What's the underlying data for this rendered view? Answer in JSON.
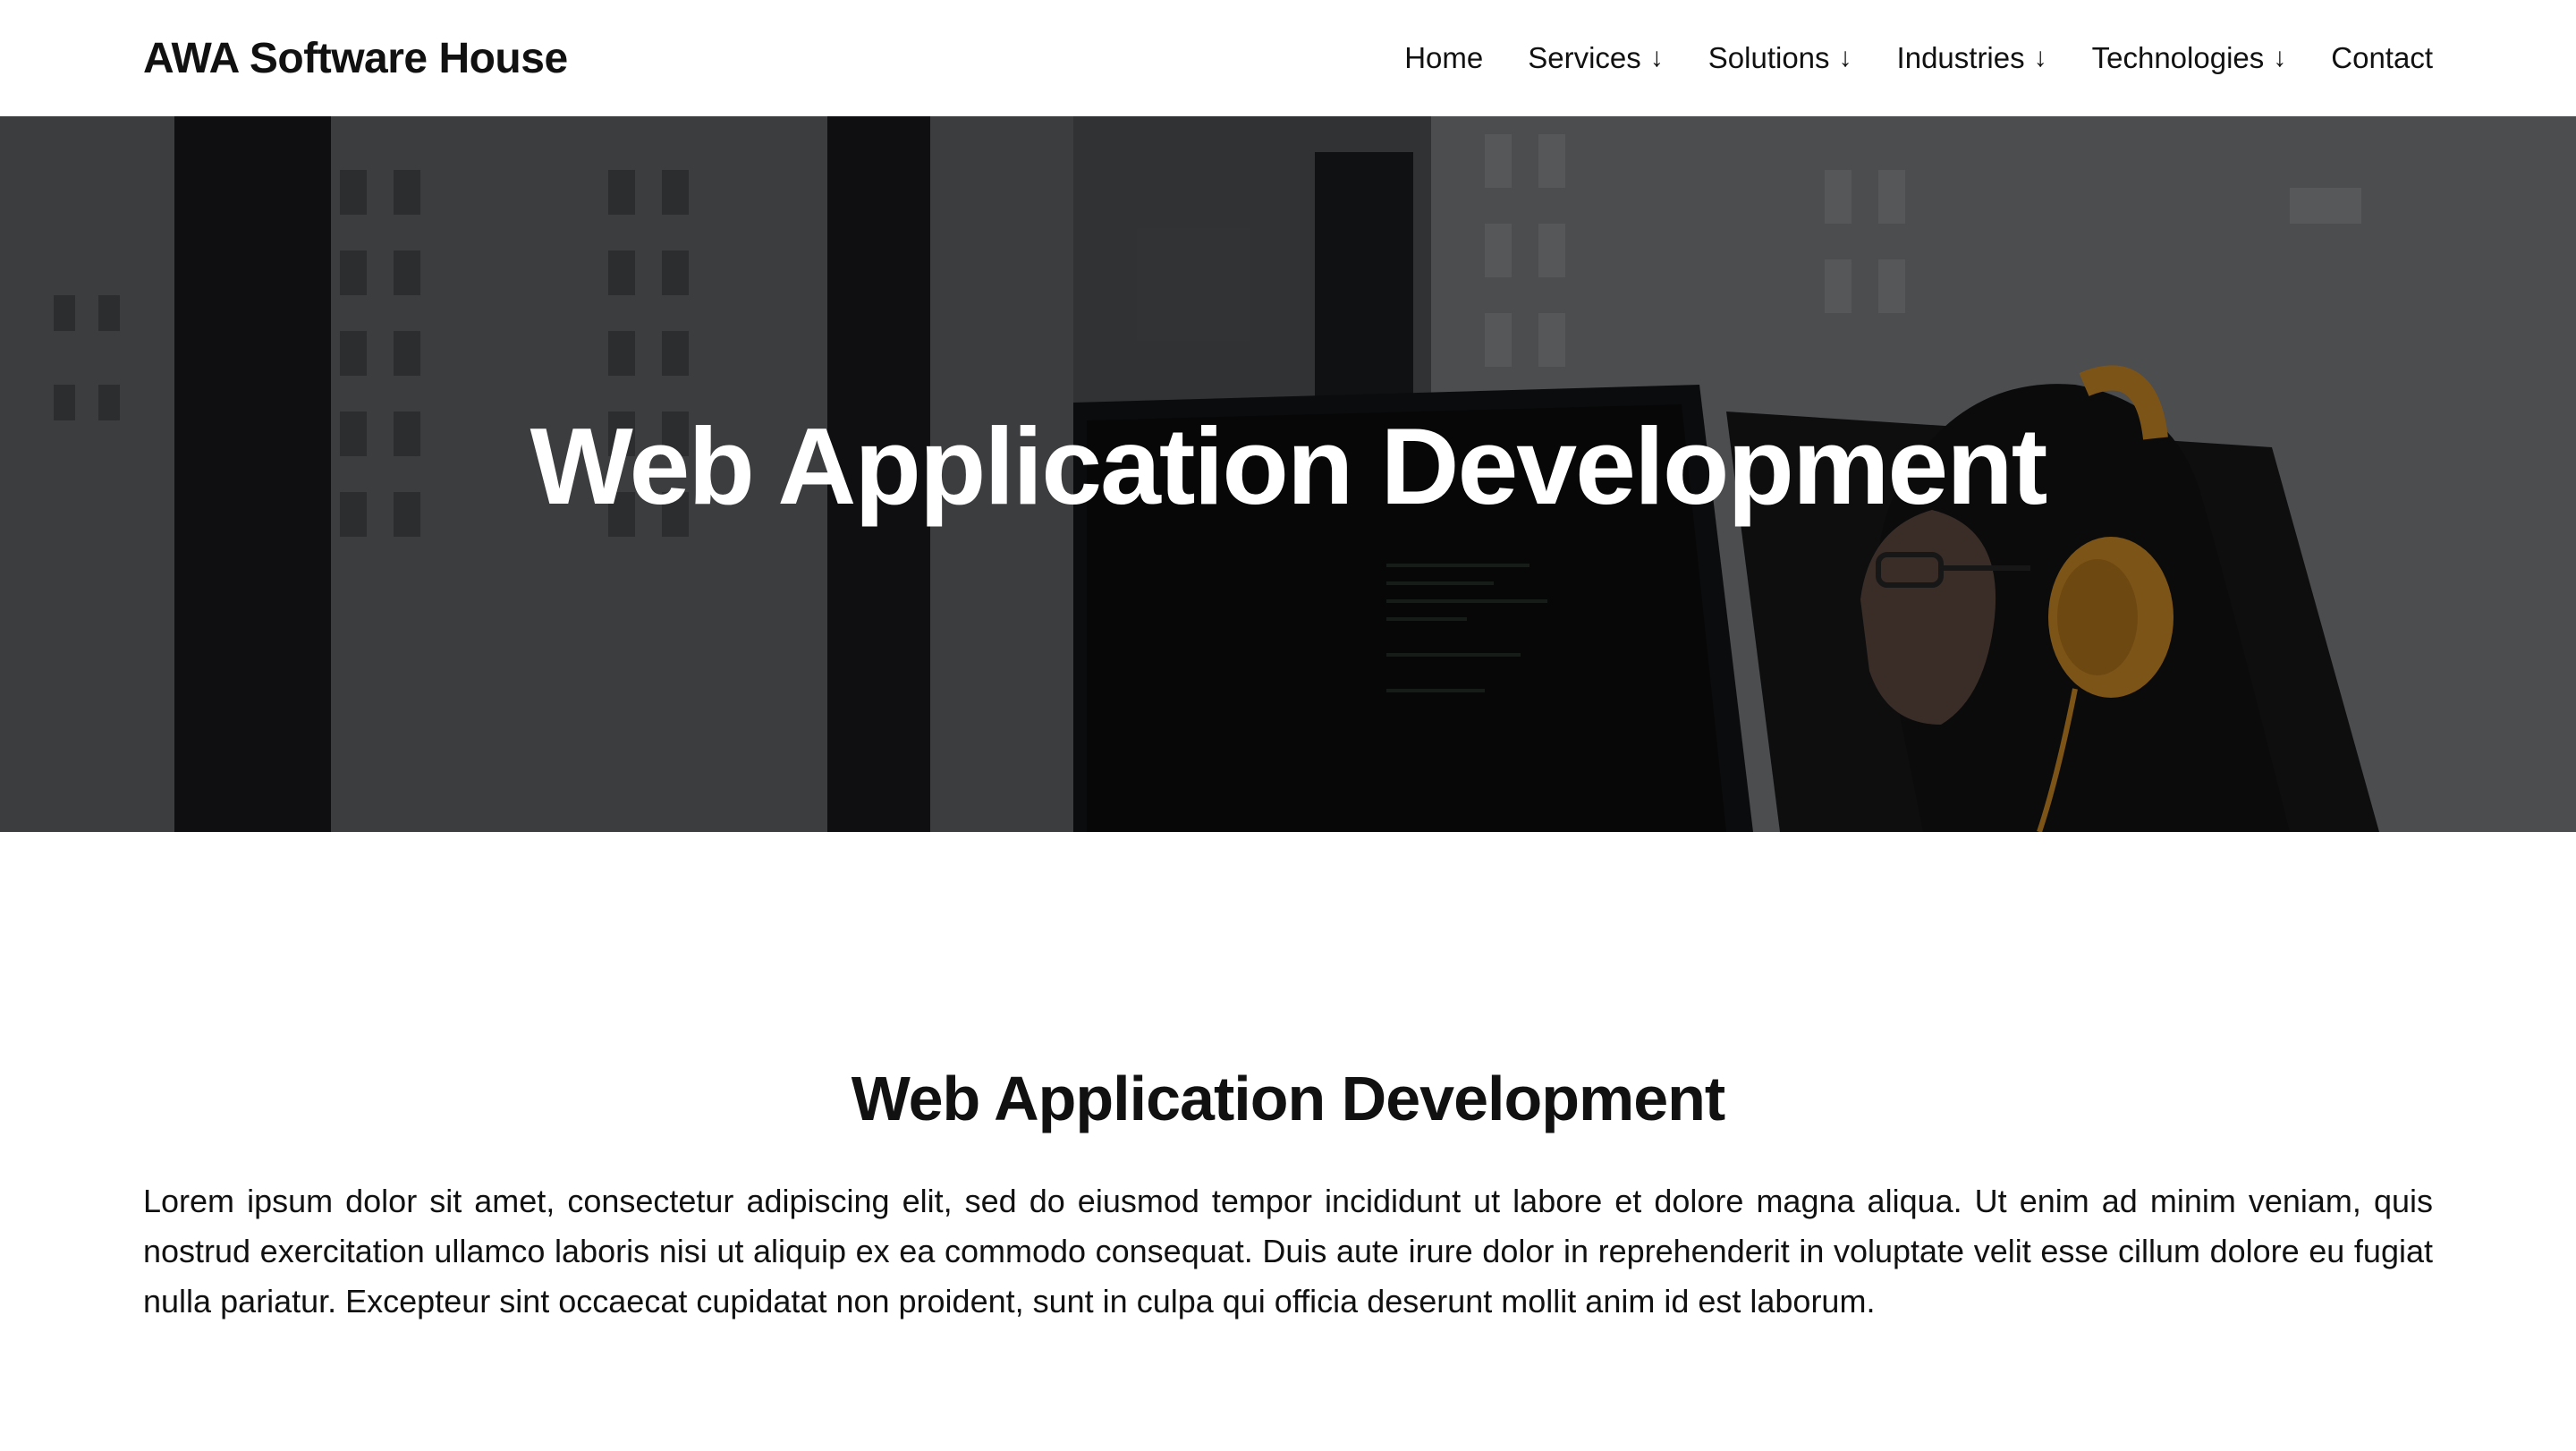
{
  "header": {
    "brand": "AWA Software House",
    "nav": [
      {
        "label": "Home",
        "dropdown": false
      },
      {
        "label": "Services",
        "dropdown": true
      },
      {
        "label": "Solutions",
        "dropdown": true
      },
      {
        "label": "Industries",
        "dropdown": true
      },
      {
        "label": "Technologies",
        "dropdown": true
      },
      {
        "label": "Contact",
        "dropdown": false
      }
    ],
    "dropdown_icon": "arrow-down-icon"
  },
  "hero": {
    "title": "Web Application Development",
    "image": "woman-with-headphones-coding-at-monitors-photo"
  },
  "main": {
    "title": "Web Application Development",
    "body": "Lorem ipsum dolor sit amet, consectetur adipiscing elit, sed do eiusmod tempor incididunt ut labore et dolore magna aliqua. Ut enim ad minim veniam, quis nostrud exercitation ullamco laboris nisi ut aliquip ex ea commodo consequat. Duis aute irure dolor in reprehenderit in voluptate velit esse cillum dolore eu fugiat nulla pariatur. Excepteur sint occaecat cupidatat non proident, sunt in culpa qui officia deserunt mollit anim id est laborum."
  },
  "colors": {
    "text": "#111111",
    "background": "#ffffff",
    "hero_overlay": "#000000",
    "headphones": "#e39a2a"
  }
}
